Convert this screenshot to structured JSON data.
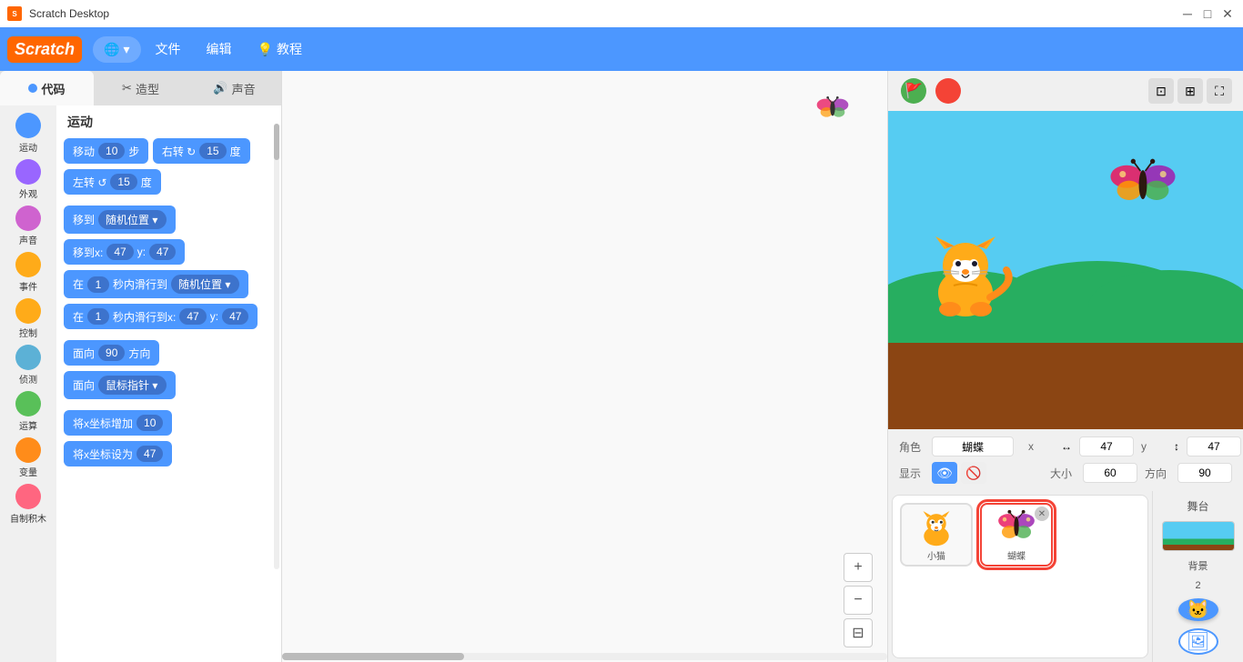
{
  "titlebar": {
    "title": "Scratch Desktop",
    "minimize": "─",
    "maximize": "□",
    "close": "✕"
  },
  "menubar": {
    "logo": "Scratch",
    "globe_label": "🌐",
    "globe_arrow": "▾",
    "file_label": "文件",
    "edit_label": "编辑",
    "tutorial_icon": "💡",
    "tutorial_label": "教程"
  },
  "tabs": {
    "code_label": "代码",
    "costume_label": "造型",
    "sound_label": "声音"
  },
  "categories": [
    {
      "name": "运动",
      "color": "#4c97ff"
    },
    {
      "name": "外观",
      "color": "#9966ff"
    },
    {
      "name": "声音",
      "color": "#cf63cf"
    },
    {
      "name": "事件",
      "color": "#ffab19"
    },
    {
      "name": "控制",
      "color": "#ffab19"
    },
    {
      "name": "侦测",
      "color": "#5cb1d6"
    },
    {
      "name": "运算",
      "color": "#59c059"
    },
    {
      "name": "变量",
      "color": "#ff8c1a"
    },
    {
      "name": "自制积木",
      "color": "#ff6680"
    }
  ],
  "section_title": "运动",
  "blocks": [
    {
      "text": "移动",
      "input": "10",
      "suffix": "步"
    },
    {
      "text": "右转 ↻",
      "input": "15",
      "suffix": "度"
    },
    {
      "text": "左转 ↺",
      "input": "15",
      "suffix": "度"
    },
    {
      "text": "移到",
      "dropdown": "随机位置▾"
    },
    {
      "text": "移到x:",
      "input": "47",
      "mid": "y:",
      "input2": "47"
    },
    {
      "text": "在",
      "input": "1",
      "mid": "秒内滑行到",
      "dropdown": "随机位置▾"
    },
    {
      "text": "在",
      "input": "1",
      "mid": "秒内滑行到x:",
      "input2": "47",
      "suffix2": "y:",
      "input3": "47"
    },
    {
      "text": "面向",
      "input": "90",
      "suffix": "方向"
    },
    {
      "text": "面向",
      "dropdown": "鼠标指针▾"
    },
    {
      "text": "将x坐标增加",
      "input": "10"
    },
    {
      "text": "将x坐标设为",
      "input": "47"
    }
  ],
  "stage": {
    "flag_color": "#4caf50",
    "stop_color": "#f44336"
  },
  "sprite_info": {
    "sprite_label": "角色",
    "sprite_name": "蝴蝶",
    "x_label": "x",
    "x_value": "47",
    "y_label": "y",
    "y_value": "47",
    "show_label": "显示",
    "size_label": "大小",
    "size_value": "60",
    "dir_label": "方向",
    "dir_value": "90",
    "stage_label": "舞台",
    "bg_count": "背景",
    "bg_num": "2"
  },
  "sprites": [
    {
      "name": "小猫",
      "selected": false
    },
    {
      "name": "蝴蝶",
      "selected": true
    }
  ],
  "zoom": {
    "in": "+",
    "out": "−",
    "fit": "⊟"
  }
}
